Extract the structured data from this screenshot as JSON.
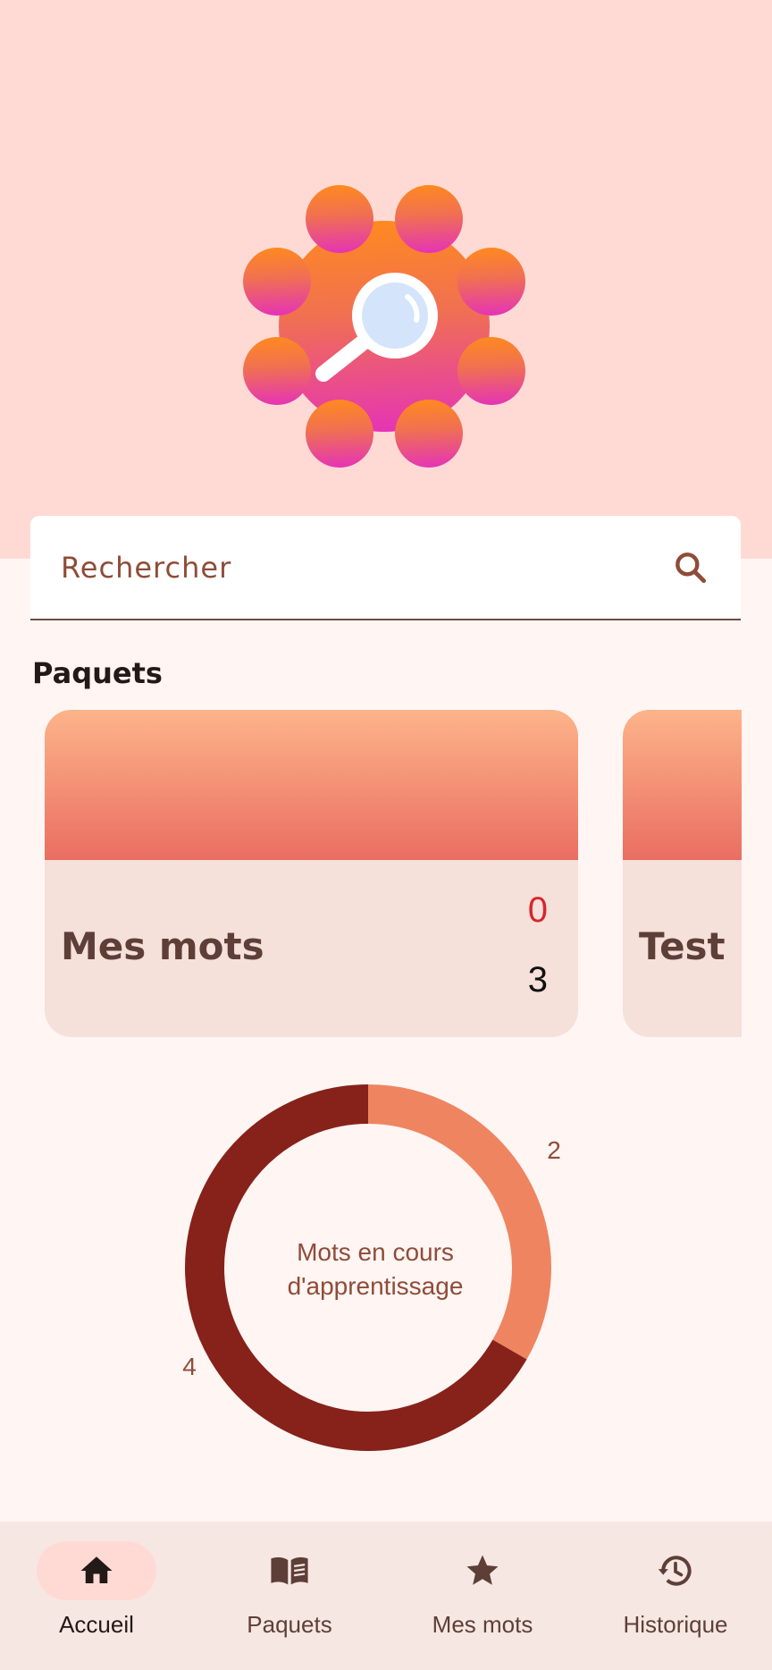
{
  "search": {
    "placeholder": "Rechercher"
  },
  "section": {
    "title": "Paquets"
  },
  "cards": [
    {
      "title": "Mes mots",
      "count_red": "0",
      "count_dark": "3"
    },
    {
      "title": "Test"
    }
  ],
  "chart_data": {
    "type": "pie",
    "title": "Mots en cours d'apprentissage",
    "categories": [
      "",
      ""
    ],
    "values": [
      2,
      4
    ],
    "labels": [
      "2",
      "4"
    ],
    "colors": [
      "#ee8560",
      "#86221a"
    ]
  },
  "center_label": {
    "line1": "Mots en cours",
    "line2": "d'apprentissage"
  },
  "nav": {
    "items": [
      {
        "label": "Accueil",
        "icon": "home-icon",
        "active": true
      },
      {
        "label": "Paquets",
        "icon": "book-icon",
        "active": false
      },
      {
        "label": "Mes mots",
        "icon": "star-icon",
        "active": false
      },
      {
        "label": "Historique",
        "icon": "history-icon",
        "active": false
      }
    ]
  },
  "colors": {
    "banner": "#ffdad5",
    "background": "#fff5f3",
    "accent": "#8f4c38",
    "nav_bg": "#f6e7e3"
  }
}
